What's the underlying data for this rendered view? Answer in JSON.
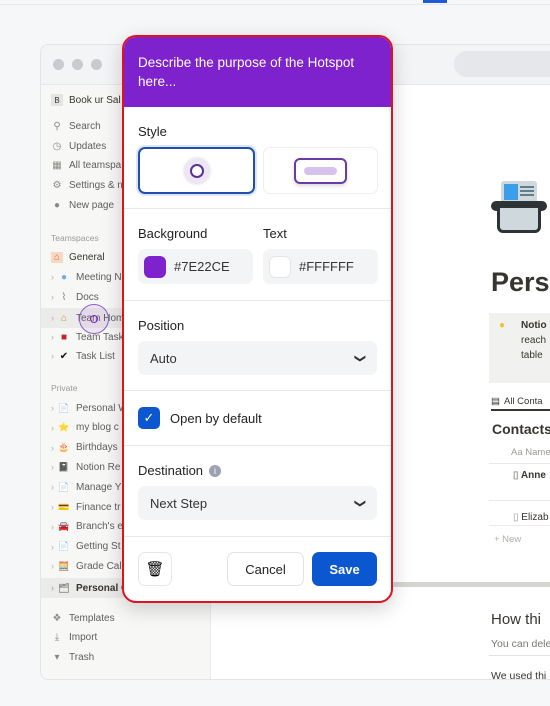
{
  "sidebar": {
    "workspace_initial": "B",
    "workspace_name": "Book ur Sal",
    "nav": [
      {
        "label": "Search",
        "icon": "search-icon"
      },
      {
        "label": "Updates",
        "icon": "clock-icon"
      },
      {
        "label": "All teamspa",
        "icon": "building-icon"
      },
      {
        "label": "Settings & m",
        "icon": "gear-icon"
      },
      {
        "label": "New page",
        "icon": "plus-circle-icon"
      }
    ],
    "teamspaces_label": "Teamspaces",
    "teamspaces": [
      {
        "label": "General",
        "icon": "🏠"
      },
      {
        "label": "Meeting N",
        "icon": "💬"
      },
      {
        "label": "Docs",
        "icon": "📎"
      },
      {
        "label": "Team Hom",
        "icon": "🏠"
      },
      {
        "label": "Team Task",
        "icon": "👕"
      },
      {
        "label": "Task List",
        "icon": "✔"
      }
    ],
    "private_label": "Private",
    "private": [
      {
        "label": "Personal W",
        "icon": "📄"
      },
      {
        "label": "my blog c",
        "icon": "⭐"
      },
      {
        "label": "Birthdays",
        "icon": "🎂"
      },
      {
        "label": "Notion Re",
        "icon": "📓"
      },
      {
        "label": "Manage Y",
        "icon": "📄"
      },
      {
        "label": "Finance tr",
        "icon": "💳"
      },
      {
        "label": "Branch's e",
        "icon": "🚘"
      },
      {
        "label": "Getting St",
        "icon": "📄"
      },
      {
        "label": "Grade Cal",
        "icon": "🧮"
      },
      {
        "label": "Personal C",
        "icon": "🗂"
      }
    ],
    "footer": [
      {
        "label": "Templates",
        "icon": "templates-icon"
      },
      {
        "label": "Import",
        "icon": "download-icon"
      },
      {
        "label": "Trash",
        "icon": "trash-icon"
      }
    ]
  },
  "page": {
    "title": "Perso",
    "callout_lines": [
      "Notio",
      "reach",
      "table"
    ],
    "view_tab": "All Conta",
    "db_title": "Contacts",
    "column_name": "Aa Name",
    "rows": [
      "Anne",
      "Elizab"
    ],
    "new_label": "+ New",
    "section_title": "How thi",
    "section_text": "You can dele",
    "section_text2": "We used thi"
  },
  "popup": {
    "description": "Describe the purpose of the Hotspot here...",
    "style_label": "Style",
    "background_label": "Background",
    "background_value": "#7E22CE",
    "text_label": "Text",
    "text_value": "#FFFFFF",
    "position_label": "Position",
    "position_value": "Auto",
    "open_by_default_label": "Open by default",
    "open_by_default": true,
    "destination_label": "Destination",
    "destination_value": "Next Step",
    "cancel_label": "Cancel",
    "save_label": "Save"
  },
  "colors": {
    "accent": "#7E22CE",
    "primary_button": "#0B57D0",
    "highlight_border": "#E0121F"
  }
}
